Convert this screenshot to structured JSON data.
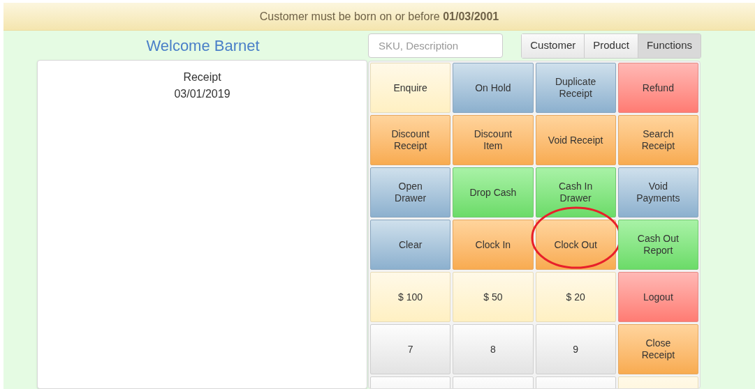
{
  "banner": {
    "text": "Customer must be born on or before **01/03/2001**"
  },
  "welcome": "Welcome Barnet",
  "receipt": {
    "title": "Receipt",
    "date": "03/01/2019"
  },
  "search": {
    "placeholder": "SKU, Description"
  },
  "tabs": [
    {
      "label": "Customer",
      "selected": false
    },
    {
      "label": "Product",
      "selected": false
    },
    {
      "label": "Functions",
      "selected": true
    }
  ],
  "buttons": [
    {
      "label": "Enquire",
      "kind": "cream",
      "circled": false
    },
    {
      "label": "On Hold",
      "kind": "blue",
      "circled": false
    },
    {
      "label": "Duplicate Receipt",
      "kind": "blue",
      "circled": false
    },
    {
      "label": "Refund",
      "kind": "red",
      "circled": false
    },
    {
      "label": "Discount Receipt",
      "kind": "orange",
      "circled": false
    },
    {
      "label": "Discount Item",
      "kind": "orange",
      "circled": false
    },
    {
      "label": "Void Receipt",
      "kind": "orange",
      "circled": false
    },
    {
      "label": "Search Receipt",
      "kind": "orange",
      "circled": false
    },
    {
      "label": "Open Drawer",
      "kind": "blue",
      "circled": false
    },
    {
      "label": "Drop Cash",
      "kind": "green",
      "circled": false
    },
    {
      "label": "Cash In Drawer",
      "kind": "green",
      "circled": false
    },
    {
      "label": "Void Payments",
      "kind": "blue",
      "circled": false
    },
    {
      "label": "Clear",
      "kind": "blue",
      "circled": false
    },
    {
      "label": "Clock In",
      "kind": "orange",
      "circled": false
    },
    {
      "label": "Clock Out",
      "kind": "orange",
      "circled": true
    },
    {
      "label": "Cash Out Report",
      "kind": "green",
      "circled": false
    },
    {
      "label": "$ 100",
      "kind": "cream",
      "circled": false
    },
    {
      "label": "$ 50",
      "kind": "cream",
      "circled": false
    },
    {
      "label": "$ 20",
      "kind": "cream",
      "circled": false
    },
    {
      "label": "Logout",
      "kind": "red",
      "circled": false
    },
    {
      "label": "7",
      "kind": "grey",
      "circled": false
    },
    {
      "label": "8",
      "kind": "grey",
      "circled": false
    },
    {
      "label": "9",
      "kind": "grey",
      "circled": false
    },
    {
      "label": "Close Receipt",
      "kind": "orange",
      "circled": false
    },
    {
      "kind": "grey",
      "circled": false
    },
    {
      "kind": "grey",
      "circled": false
    },
    {
      "kind": "grey",
      "circled": false
    },
    {
      "kind": "cream",
      "circled": false
    }
  ]
}
